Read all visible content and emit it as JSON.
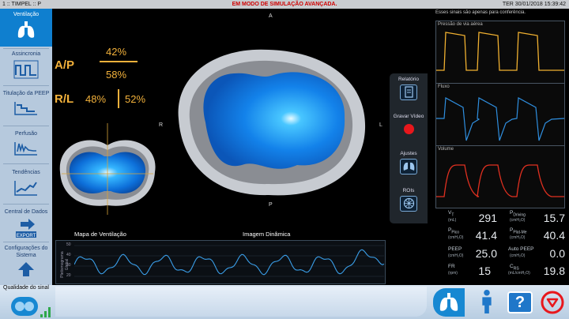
{
  "titlebar": {
    "app": "1 :: TIMPEL :: P",
    "mode": "EM MODO DE SIMULAÇÃO AVANÇADA.",
    "datetime": "TER 30/01/2018 15:39:42"
  },
  "sidebar": {
    "items": [
      {
        "label": "Ventilação",
        "icon": "lungs-icon"
      },
      {
        "label": "Assincronia",
        "icon": "asynchrony-waveform-icon"
      },
      {
        "label": "Titulação da PEEP",
        "icon": "peep-titration-icon"
      },
      {
        "label": "Perfusão",
        "icon": "perfusion-icon"
      },
      {
        "label": "Tendências",
        "icon": "trend-chart-icon"
      },
      {
        "label": "Central de Dados",
        "icon": "export-icon"
      },
      {
        "label": "Configurações do Sistema",
        "icon": "upload-arrow-icon"
      }
    ],
    "export_text": "EXPORT"
  },
  "ventilation": {
    "ap_label": "A/P",
    "ap_top": "42%",
    "ap_bottom": "58%",
    "rl_label": "R/L",
    "rl_left": "48%",
    "rl_right": "52%",
    "orientation": {
      "anterior": "A",
      "posterior": "P",
      "right": "R",
      "left": "L"
    },
    "map_caption": "Mapa de Ventilação",
    "dynamic_caption": "Imagem Dinâmica",
    "pleth_axis_label": "Pletismograma Global",
    "pleth_ticks": [
      "50",
      "40",
      "30",
      "20"
    ]
  },
  "actions": {
    "report": "Relatório",
    "record": "Gravar Vídeo",
    "adjust": "Ajustes",
    "rois": "ROIs"
  },
  "waves": {
    "note": "Esses sinais são apenas para conferência.",
    "pressure_title": "Pressão de via aérea",
    "flow_title": "Fluxo",
    "volume_title": "Volume",
    "pressure_color": "#f0b030",
    "flow_color": "#2f8fe0",
    "volume_color": "#e03020"
  },
  "numbers": {
    "vt": {
      "label": "V",
      "sub": "T",
      "unit": "(mL)",
      "value": "291"
    },
    "pdriving": {
      "label": "P",
      "sub": "Driving",
      "unit": "(cmH₂O)",
      "value": "15.7"
    },
    "ppico": {
      "label": "P",
      "sub": "Pico",
      "unit": "(cmH₂O)",
      "value": "41.4"
    },
    "pplat": {
      "label": "P",
      "sub": "Plat-Me",
      "unit": "(cmH₂O)",
      "value": "40.4"
    },
    "peep": {
      "label": "PEEP",
      "unit": "(cmH₂O)",
      "value": "25.0"
    },
    "autopeep": {
      "label": "Auto PEEP",
      "unit": "(cmH₂O)",
      "value": "0.0"
    },
    "fr": {
      "label": "FR",
      "unit": "(rpm)",
      "value": "15"
    },
    "crs": {
      "label": "C",
      "sub": "RS",
      "unit": "(mL/cmH₂O)",
      "value": "19.8"
    }
  },
  "bottombar": {
    "signal_quality": "Qualidade do sinal"
  }
}
